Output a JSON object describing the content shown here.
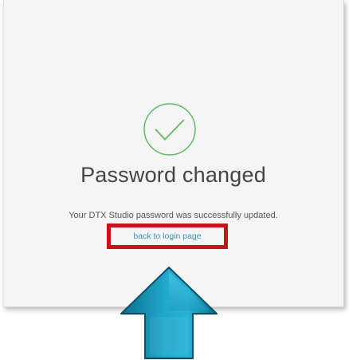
{
  "dialog": {
    "title": "Password changed",
    "message": "Your DTX Studio password was successfully updated.",
    "back_link_label": "back to login page"
  },
  "icons": {
    "success": "check-circle-icon",
    "pointer": "up-arrow-icon"
  },
  "colors": {
    "success": "#5cb85c",
    "link": "#3c8fc6",
    "highlight": "#c8131b",
    "arrow": "#1b9cbf"
  }
}
